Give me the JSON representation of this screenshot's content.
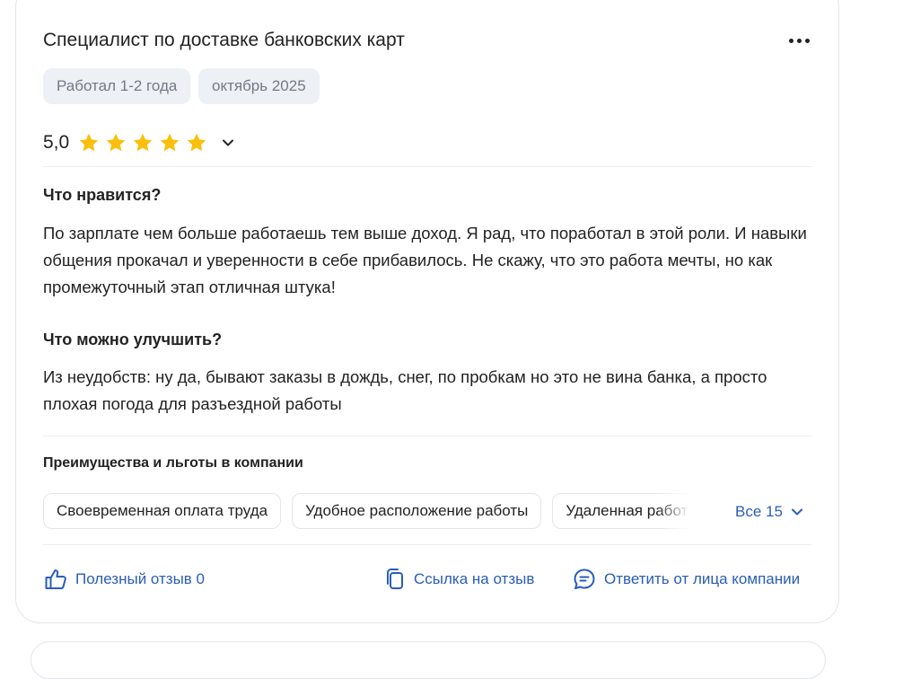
{
  "review": {
    "title": "Специалист по доставке банковских карт",
    "tags": [
      "Работал 1-2 года",
      "октябрь 2025"
    ],
    "rating": {
      "value_text": "5,0",
      "stars": 5,
      "max_stars": 5,
      "star_color": "#fbbf0c"
    },
    "pros": {
      "heading": "Что нравится?",
      "text": "По зарплате чем больше работаешь тем выше доход. Я рад, что поработал в этой роли. И навыки общения прокачал и уверенности в себе прибавилось. Не скажу, что это работа мечты, но как промежуточный этап отличная штука!"
    },
    "cons": {
      "heading": "Что можно улучшить?",
      "text": "Из неудобств: ну да, бывают заказы в дождь, снег, по пробкам но это не вина банка, а просто плохая погода для разъездной работы"
    },
    "benefits": {
      "heading": "Преимущества и льготы в компании",
      "items": [
        "Своевременная оплата труда",
        "Удобное расположение работы",
        "Удаленная работа"
      ],
      "all_label": "Все 15"
    },
    "actions": {
      "helpful_label": "Полезный отзыв 0",
      "link_label": "Ссылка на отзыв",
      "reply_label": "Ответить от лица компании"
    }
  },
  "colors": {
    "accent": "#2a5db8",
    "tag_bg": "#edf0f5",
    "tag_text": "#737a85",
    "border": "#e3e5ea"
  },
  "icons": {
    "more": "more-horizontal-icon",
    "chevron": "chevron-down-icon",
    "star": "star-icon",
    "thumb": "thumbs-up-icon",
    "copy": "copy-link-icon",
    "reply": "chat-bubble-icon"
  }
}
